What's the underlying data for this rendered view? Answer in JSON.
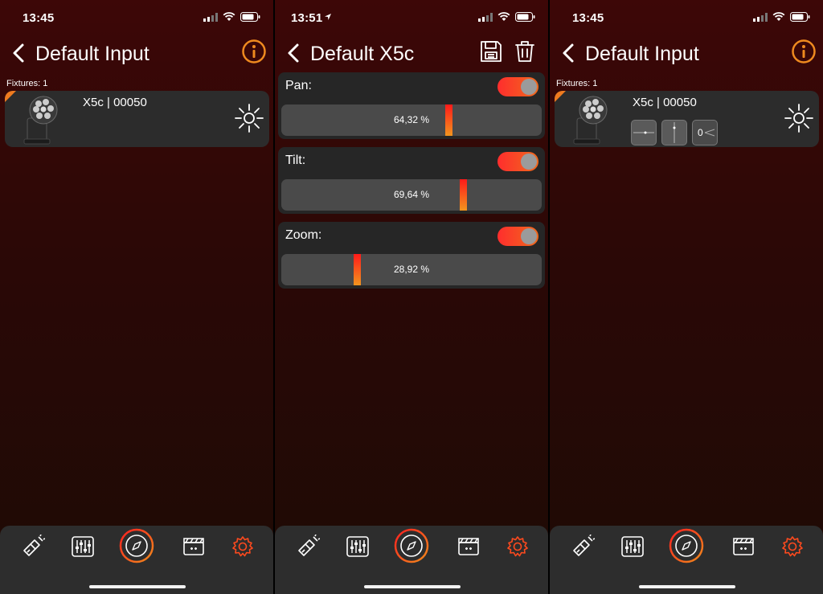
{
  "screens": [
    {
      "status": {
        "time": "13:45"
      },
      "nav": {
        "title": "Default Input"
      },
      "fixtures_label": "Fixtures: 1",
      "fixture": {
        "name": "X5c | 00050"
      }
    },
    {
      "status": {
        "time": "13:51"
      },
      "nav": {
        "title": "Default X5c"
      },
      "params": [
        {
          "name": "Pan:",
          "value": "64,32 %",
          "fraction": 0.6432,
          "enabled": true
        },
        {
          "name": "Tilt:",
          "value": "69,64 %",
          "fraction": 0.6964,
          "enabled": true
        },
        {
          "name": "Zoom:",
          "value": "28,92 %",
          "fraction": 0.2892,
          "enabled": true
        }
      ]
    },
    {
      "status": {
        "time": "13:45"
      },
      "nav": {
        "title": "Default Input"
      },
      "fixtures_label": "Fixtures: 1",
      "fixture": {
        "name": "X5c | 00050",
        "zoom_readout": "0"
      }
    }
  ],
  "tabbar": {
    "items": [
      "flashlight-tab",
      "mixer-tab",
      "compass-tab",
      "clapper-tab",
      "settings-tab"
    ],
    "active": "compass-tab"
  },
  "colors": {
    "accent": "#ef8a1f",
    "toggle_on": "#f5452a",
    "settings": "#ff4a1e"
  }
}
